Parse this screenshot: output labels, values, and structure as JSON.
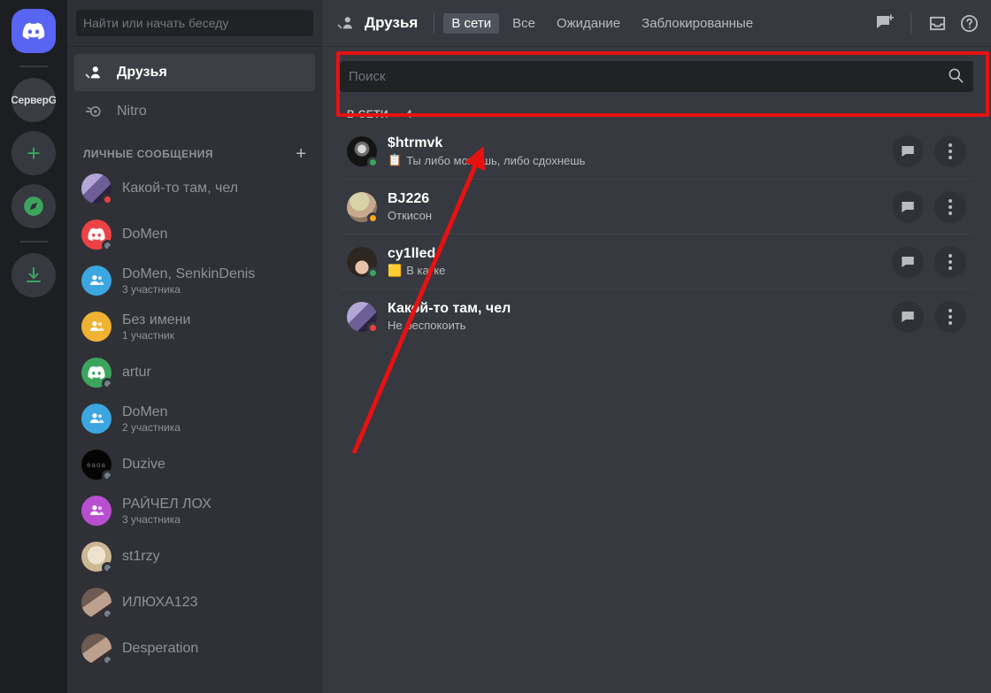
{
  "server_rail": {
    "items": [
      {
        "name": "discord-home",
        "label": "",
        "kind": "home",
        "active": true
      },
      {
        "name": "server-g",
        "label": "СерверG",
        "kind": "server"
      },
      {
        "name": "add-server",
        "label": "+",
        "kind": "plus"
      },
      {
        "name": "explore-servers",
        "label": "",
        "kind": "compass"
      },
      {
        "name": "download-apps",
        "label": "",
        "kind": "download"
      }
    ]
  },
  "sidebar": {
    "search_placeholder": "Найти или начать беседу",
    "nav": [
      {
        "label": "Друзья",
        "icon": "friends-icon",
        "active": true
      },
      {
        "label": "Nitro",
        "icon": "nitro-icon",
        "active": false
      }
    ],
    "dm_section_title": "ЛИЧНЫЕ СООБЩЕНИЯ",
    "dm_add_label": "+",
    "dms": [
      {
        "name": "Какой-то там, чел",
        "sub": "",
        "status": "dnd",
        "avatar_color": "#7b68a8",
        "avatar_type": "photo-purple"
      },
      {
        "name": "DoMen",
        "sub": "",
        "status": "offline",
        "avatar_color": "#ed4245",
        "avatar_type": "discord-logo"
      },
      {
        "name": "DoMen, SenkinDenis",
        "sub": "3 участника",
        "status": "none",
        "avatar_color": "#3ba6e0",
        "avatar_type": "group"
      },
      {
        "name": "Без имени",
        "sub": "1 участник",
        "status": "none",
        "avatar_color": "#f0b232",
        "avatar_type": "group"
      },
      {
        "name": "artur",
        "sub": "",
        "status": "offline",
        "avatar_color": "#3ba55d",
        "avatar_type": "discord-logo"
      },
      {
        "name": "DoMen",
        "sub": "2 участника",
        "status": "none",
        "avatar_color": "#3ba6e0",
        "avatar_type": "group"
      },
      {
        "name": "Duzive",
        "sub": "",
        "status": "offline",
        "avatar_color": "#000000",
        "avatar_type": "dark-photo"
      },
      {
        "name": "РАЙЧЕЛ ЛОХ",
        "sub": "3 участника",
        "status": "none",
        "avatar_color": "#b84fd1",
        "avatar_type": "group"
      },
      {
        "name": "st1rzy",
        "sub": "",
        "status": "offline",
        "avatar_color": "#c9b79c",
        "avatar_type": "cat-photo"
      },
      {
        "name": "ИЛЮХА123",
        "sub": "",
        "status": "offline",
        "avatar_color": "#8f7a6e",
        "avatar_type": "person-photo"
      },
      {
        "name": "Desperation",
        "sub": "",
        "status": "offline",
        "avatar_color": "#4a5a6a",
        "avatar_type": "person-photo"
      }
    ]
  },
  "topbar": {
    "title": "Друзья",
    "tabs": [
      {
        "label": "В сети",
        "active": true
      },
      {
        "label": "Все",
        "active": false
      },
      {
        "label": "Ожидание",
        "active": false
      },
      {
        "label": "Заблокированные",
        "active": false
      }
    ],
    "icons": [
      {
        "name": "new-group-dm-icon"
      },
      {
        "name": "inbox-icon"
      },
      {
        "name": "help-icon"
      }
    ]
  },
  "main": {
    "search_placeholder": "Поиск",
    "section_title": "В СЕТИ — 4",
    "friends": [
      {
        "name": "$htrmvk",
        "status_text": "Ты либо можешь, либо сдохнешь",
        "status_emoji": "📋",
        "presence": "online",
        "avatar_color": "#0d0d0d",
        "avatar_type": "skull"
      },
      {
        "name": "BJ226",
        "status_text": "Откисон",
        "status_emoji": "",
        "presence": "idle",
        "avatar_color": "#c8b99a",
        "avatar_type": "dog-meme"
      },
      {
        "name": "cy1lled",
        "status_text": "В катке",
        "status_emoji": "🟨",
        "presence": "online",
        "avatar_color": "#6b5a4a",
        "avatar_type": "anime"
      },
      {
        "name": "Какой-то там, чел",
        "status_text": "Не беспокоить",
        "status_emoji": "",
        "presence": "dnd",
        "avatar_color": "#7b68a8",
        "avatar_type": "photo-purple"
      }
    ],
    "row_action_message": "message-icon",
    "row_action_more": "more-options-icon"
  },
  "annotations": {
    "highlight_color": "#e81111",
    "rect_label": "search-field-highlight",
    "arrow_label": "pointer-arrow-to-search"
  }
}
